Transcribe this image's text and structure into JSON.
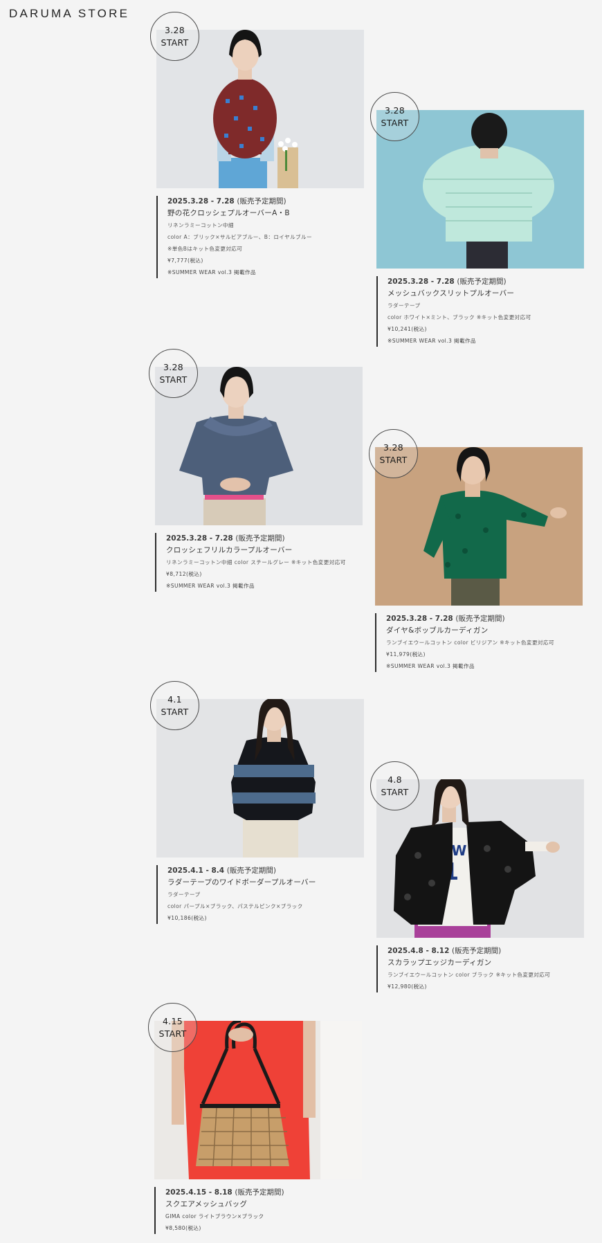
{
  "header": {
    "logo": "DARUMA STORE"
  },
  "cards": [
    {
      "badge_date": "3.28",
      "badge_label": "START",
      "period": "2025.3.28 - 7.28",
      "period_note": "(販売予定期間)",
      "title": "野の花クロッシェプルオーバーA・B",
      "lines": [
        "リネンラミーコットン中細",
        "color A：ブリック×サルビアブルー、B：ロイヤルブルー",
        "※単色Bはキット色変更対応可",
        "¥7,777(税込)",
        "※SUMMER WEAR vol.3 掲載作品"
      ],
      "photo_alt": "brown crochet sweater with blue flowers"
    },
    {
      "badge_date": "3.28",
      "badge_label": "START",
      "period": "2025.3.28 - 7.28",
      "period_note": "(販売予定期間)",
      "title": "メッシュバックスリットプルオーバー",
      "lines": [
        "ラダーテープ",
        "color ホワイト×ミント、ブラック ※キット色変更対応可",
        "¥10,241(税込)",
        "※SUMMER WEAR vol.3 掲載作品"
      ],
      "photo_alt": "mint mesh pullover back view"
    },
    {
      "badge_date": "3.28",
      "badge_label": "START",
      "period": "2025.3.28 - 7.28",
      "period_note": "(販売予定期間)",
      "title": "クロッシェフリルカラープルオーバー",
      "lines": [
        "リネンラミーコットン中細 color スチールグレー ※キット色変更対応可",
        "¥8,712(税込)",
        "※SUMMER WEAR vol.3 掲載作品"
      ],
      "photo_alt": "steel grey frill collar pullover"
    },
    {
      "badge_date": "3.28",
      "badge_label": "START",
      "period": "2025.3.28 - 7.28",
      "period_note": "(販売予定期間)",
      "title": "ダイヤ&ボッブルカーディガン",
      "lines": [
        "ランブイエウールコットン color ビリジアン ※キット色変更対応可",
        "¥11,979(税込)",
        "※SUMMER WEAR vol.3 掲載作品"
      ],
      "photo_alt": "green bobble cardigan"
    },
    {
      "badge_date": "4.1",
      "badge_label": "START",
      "period": "2025.4.1 - 8.4",
      "period_note": "(販売予定期間)",
      "title": "ラダーテープのワイドボーダープルオーバー",
      "lines": [
        "ラダーテープ",
        "color パープル×ブラック、パステルピンク×ブラック",
        "¥10,186(税込)"
      ],
      "photo_alt": "black and blue wide border pullover"
    },
    {
      "badge_date": "4.8",
      "badge_label": "START",
      "period": "2025.4.8 - 8.12",
      "period_note": "(販売予定期間)",
      "title": "スカラップエッジカーディガン",
      "lines": [
        "ランブイエウールコットン color ブラック ※キット色変更対応可",
        "¥12,980(税込)"
      ],
      "photo_alt": "black scallop edge cardigan"
    },
    {
      "badge_date": "4.15",
      "badge_label": "START",
      "period": "2025.4.15 - 8.18",
      "period_note": "(販売予定期間)",
      "title": "スクエアメッシュバッグ",
      "lines": [
        "GIMA color ライトブラウン×ブラック",
        "¥8,580(税込)"
      ],
      "photo_alt": "square mesh bag"
    }
  ]
}
